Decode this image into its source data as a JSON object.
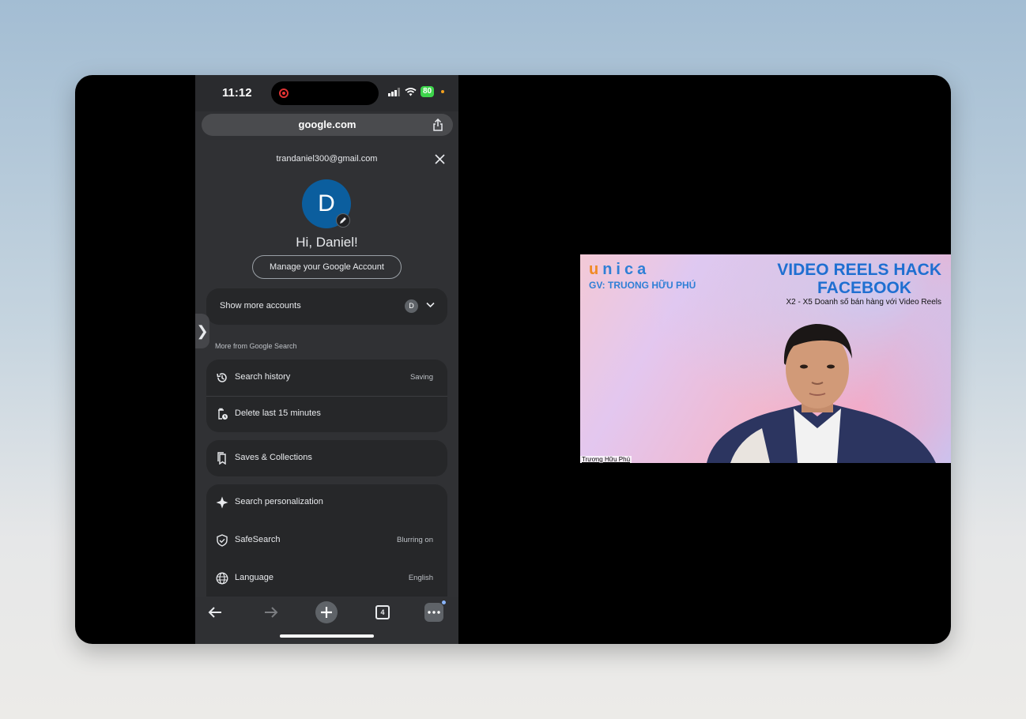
{
  "status": {
    "time": "11:12",
    "battery": "80"
  },
  "browser": {
    "url": "google.com"
  },
  "account": {
    "email": "trandaniel300@gmail.com",
    "avatar_letter": "D",
    "greeting": "Hi, Daniel!",
    "manage_label": "Manage your Google Account",
    "show_more_label": "Show more accounts",
    "small_avatar_letter": "D"
  },
  "section_label": "More from Google Search",
  "menu": {
    "search_history": {
      "label": "Search history",
      "value": "Saving"
    },
    "delete_last": {
      "label": "Delete last 15 minutes"
    },
    "saves": {
      "label": "Saves & Collections"
    },
    "personalization": {
      "label": "Search personalization"
    },
    "safesearch": {
      "label": "SafeSearch",
      "value": "Blurring on"
    },
    "language": {
      "label": "Language",
      "value": "English"
    }
  },
  "toolbar": {
    "tab_count": "4"
  },
  "video": {
    "brand_first": "u",
    "brand_rest": "nica",
    "teacher": "GV: TRUONG HỮU PHÚ",
    "title_line1": "VIDEO REELS HACK",
    "title_line2": "FACEBOOK",
    "subtitle": "X2 - X5 Doanh số bán hàng với Video Reels",
    "speaker_name": "Trương Hữu Phú"
  },
  "colors": {
    "accent_blue": "#1f6fd1",
    "avatar_blue": "#0b5e9e",
    "battery_green": "#3dd44b"
  }
}
